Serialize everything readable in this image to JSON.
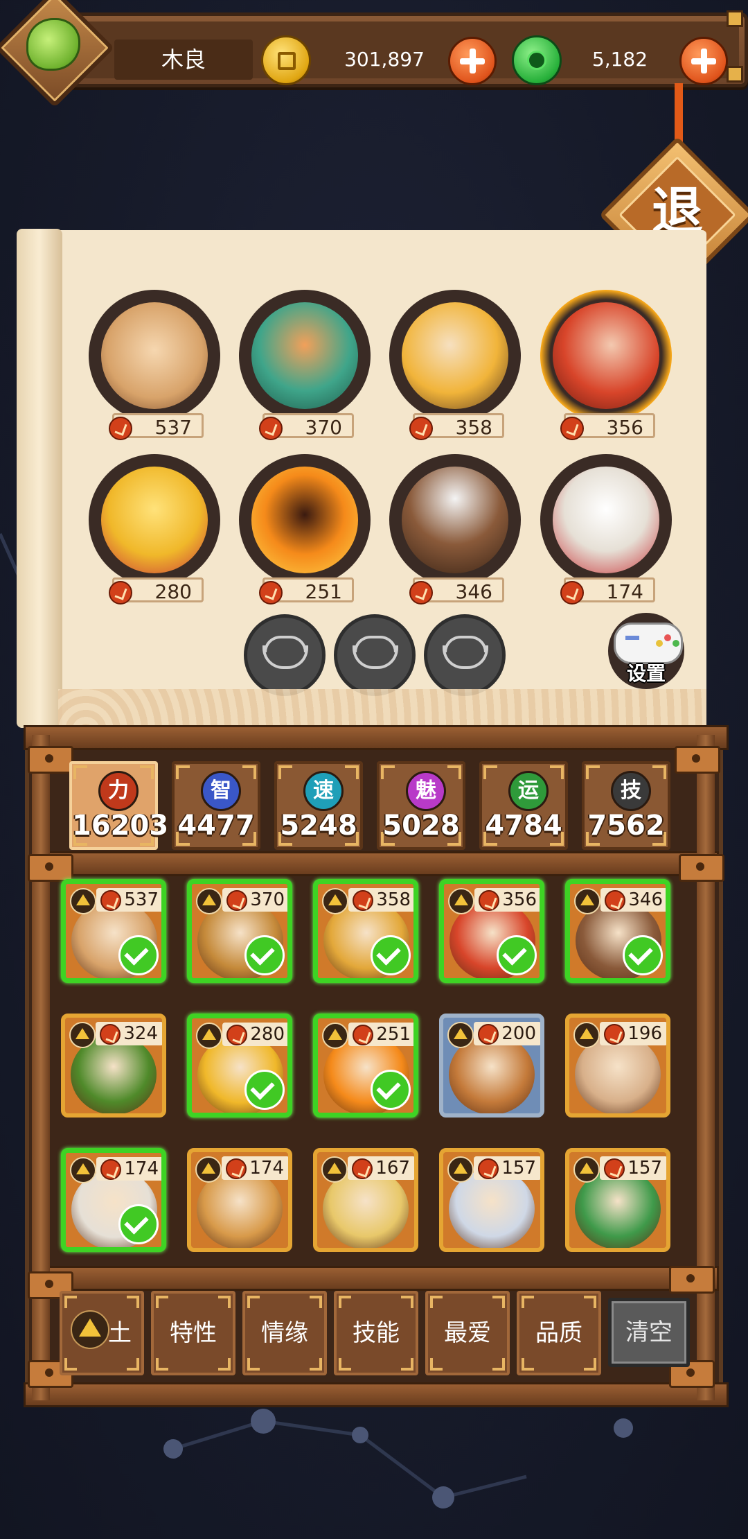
{
  "player": {
    "name": "木良"
  },
  "resources": {
    "gold": "301,897",
    "jade": "5,182"
  },
  "exit_label": "退",
  "settings_label": "设置",
  "lineup": [
    {
      "power": "537",
      "hero": "explorer-duo",
      "color": "#d8a36a"
    },
    {
      "power": "370",
      "hero": "dragon-rider",
      "color": "#3fa58a"
    },
    {
      "power": "358",
      "hero": "scroll-girl",
      "color": "#f1b43a"
    },
    {
      "power": "356",
      "hero": "flame-warrior",
      "color": "#d8452a"
    },
    {
      "power": "280",
      "hero": "yellow-boxer",
      "color": "#f0b82a"
    },
    {
      "power": "251",
      "hero": "fire-monkey",
      "color": "#f58a1a"
    },
    {
      "power": "346",
      "hero": "blind-warrior",
      "color": "#8a5a3a"
    },
    {
      "power": "174",
      "hero": "lion-dancer",
      "color": "#e6e0d6"
    }
  ],
  "empty_slots": 3,
  "attributes": [
    {
      "key": "力",
      "value": "16203",
      "color": "#c0391b",
      "active": true
    },
    {
      "key": "智",
      "value": "4477",
      "color": "#3a57c8",
      "active": false
    },
    {
      "key": "速",
      "value": "5248",
      "color": "#1f9fb8",
      "active": false
    },
    {
      "key": "魅",
      "value": "5028",
      "color": "#b83ac8",
      "active": false
    },
    {
      "key": "运",
      "value": "4784",
      "color": "#2f9a3a",
      "active": false
    },
    {
      "key": "技",
      "value": "7562",
      "color": "#3a3a3a",
      "active": false
    }
  ],
  "roster": [
    {
      "power": "537",
      "selected": true,
      "tone": "gold",
      "color": "#d8a36a"
    },
    {
      "power": "370",
      "selected": true,
      "tone": "gold",
      "color": "#c58a3a"
    },
    {
      "power": "358",
      "selected": true,
      "tone": "gold",
      "color": "#e3a83a"
    },
    {
      "power": "356",
      "selected": true,
      "tone": "gold",
      "color": "#d8452a"
    },
    {
      "power": "346",
      "selected": true,
      "tone": "gold",
      "color": "#8a5a3a"
    },
    {
      "power": "324",
      "selected": false,
      "tone": "gold",
      "color": "#4f8a2a"
    },
    {
      "power": "280",
      "selected": true,
      "tone": "gold",
      "color": "#f0b82a"
    },
    {
      "power": "251",
      "selected": true,
      "tone": "gold",
      "color": "#f58a1a"
    },
    {
      "power": "200",
      "selected": false,
      "tone": "blue",
      "color": "#c47a3a"
    },
    {
      "power": "196",
      "selected": false,
      "tone": "gold",
      "color": "#d8b08a"
    },
    {
      "power": "174",
      "selected": true,
      "tone": "gold",
      "color": "#e6e0d6"
    },
    {
      "power": "174",
      "selected": false,
      "tone": "gold",
      "color": "#d89a4a"
    },
    {
      "power": "167",
      "selected": false,
      "tone": "gold",
      "color": "#e8c86a"
    },
    {
      "power": "157",
      "selected": false,
      "tone": "gold",
      "color": "#cfd8e6"
    },
    {
      "power": "157",
      "selected": false,
      "tone": "gold",
      "color": "#3f9a4a"
    }
  ],
  "filters": [
    {
      "label": "土"
    },
    {
      "label": "特性"
    },
    {
      "label": "情缘"
    },
    {
      "label": "技能"
    },
    {
      "label": "最爱"
    },
    {
      "label": "品质"
    }
  ],
  "clear_label": "清空"
}
